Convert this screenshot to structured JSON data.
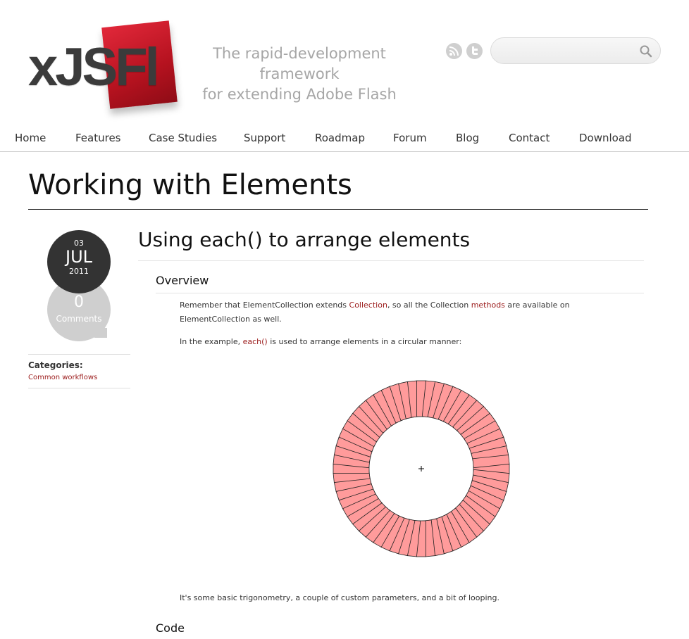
{
  "site": {
    "logo_text": "xJSFl",
    "tagline_line1": "The rapid-development framework",
    "tagline_line2": "for extending Adobe Flash",
    "search": {
      "placeholder": "",
      "value": ""
    }
  },
  "nav": [
    "Home",
    "Features",
    "Case Studies",
    "Support",
    "Roadmap",
    "Forum",
    "Blog",
    "Contact",
    "Download"
  ],
  "page": {
    "title": "Working with Elements"
  },
  "post": {
    "date": {
      "day": "03",
      "month": "JUL",
      "year": "2011"
    },
    "comments": {
      "count": "0",
      "label": "Comments"
    },
    "categories_label": "Categories:",
    "category": "Common workflows",
    "title": "Using each() to arrange elements",
    "overview_heading": "Overview",
    "p1": {
      "t1": "Remember that ElementCollection extends ",
      "link1": "Collection",
      "t2": ", so all the Collection ",
      "link2": "methods",
      "t3": " are available on",
      "t4": "ElementCollection as well."
    },
    "p2": {
      "t1": "In the example, ",
      "link": "each()",
      "t2": " is used to arrange elements in a circular manner:"
    },
    "p3": "It's some basic trigonometry, a couple of custom parameters, and a bit of looping.",
    "code_heading": "Code"
  },
  "colors": {
    "accent": "#9b1b1b",
    "segment_fill": "#ff9b9b",
    "date_bg": "#333333",
    "comments_bg": "#cfcfcf"
  },
  "icons": {
    "rss": "rss-icon",
    "twitter": "twitter-icon",
    "search": "search-icon"
  }
}
